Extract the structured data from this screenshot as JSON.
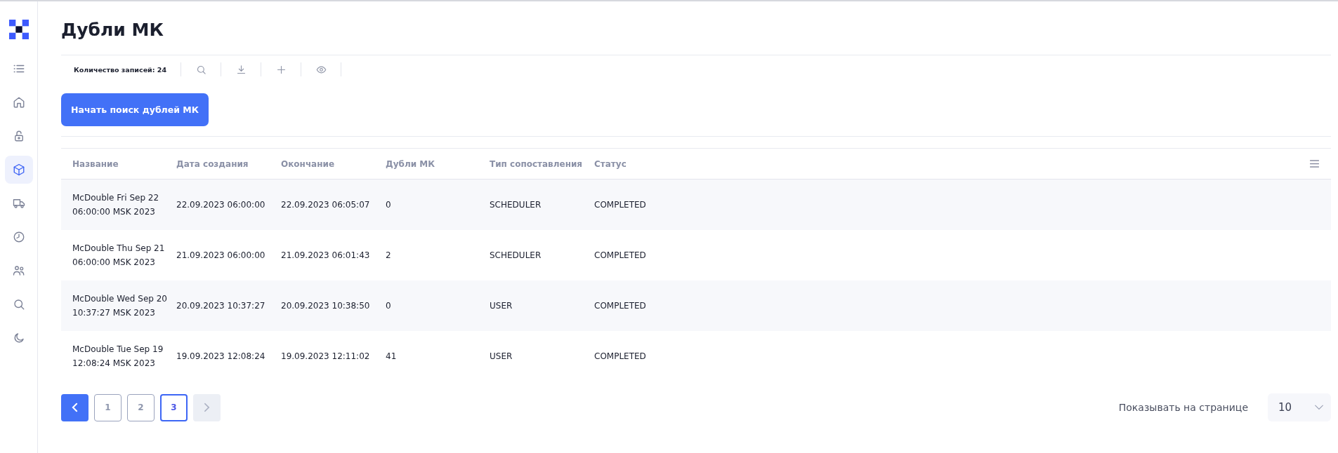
{
  "page": {
    "title": "Дубли МК"
  },
  "sidebar": {
    "items": [
      {
        "kind": "list",
        "selected": false
      },
      {
        "kind": "home",
        "selected": false
      },
      {
        "kind": "lock",
        "selected": false
      },
      {
        "kind": "box",
        "selected": true
      },
      {
        "kind": "truck",
        "selected": false
      },
      {
        "kind": "clock",
        "selected": false
      },
      {
        "kind": "users",
        "selected": false
      },
      {
        "kind": "search",
        "selected": false
      },
      {
        "kind": "moon",
        "selected": false
      }
    ]
  },
  "toolbar": {
    "count": "Количество записей: 24",
    "actions": [
      {
        "kind": "search"
      },
      {
        "kind": "download"
      },
      {
        "kind": "add"
      },
      {
        "kind": "view"
      }
    ]
  },
  "start_button": "Начать поиск дублей МК",
  "table": {
    "columns": [
      "Название",
      "Дата создания",
      "Окончание",
      "Дубли МК",
      "Тип сопоставления",
      "Статус"
    ],
    "rows": [
      [
        "McDouble Fri Sep 22 06:00:00 MSK 2023",
        "22.09.2023 06:00:00",
        "22.09.2023 06:05:07",
        "0",
        "SCHEDULER",
        "COMPLETED"
      ],
      [
        "McDouble Thu Sep 21 06:00:00 MSK 2023",
        "21.09.2023 06:00:00",
        "21.09.2023 06:01:43",
        "2",
        "SCHEDULER",
        "COMPLETED"
      ],
      [
        "McDouble Wed Sep 20 10:37:27 MSK 2023",
        "20.09.2023 10:37:27",
        "20.09.2023 10:38:50",
        "0",
        "USER",
        "COMPLETED"
      ],
      [
        "McDouble Tue Sep 19 12:08:24 MSK 2023",
        "19.09.2023 12:08:24",
        "19.09.2023 12:11:02",
        "41",
        "USER",
        "COMPLETED"
      ]
    ]
  },
  "pagination": {
    "prev_disabled": false,
    "next_disabled": true,
    "pages": [
      {
        "label": "1",
        "selected": false
      },
      {
        "label": "2",
        "selected": false
      },
      {
        "label": "3",
        "selected": true
      }
    ],
    "page_size_label": "Показывать на странице",
    "page_size": "10"
  }
}
